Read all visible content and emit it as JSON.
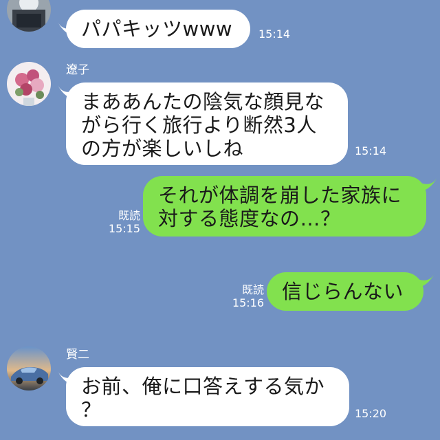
{
  "messages": [
    {
      "sender": "",
      "lines": [
        "パパキッツwww"
      ],
      "time": "15:14"
    },
    {
      "sender": "遼子",
      "lines": [
        "まああんたの陰気な顔見な",
        "がら行く旅行より断然3人",
        "の方が楽しいしね"
      ],
      "time": "15:14"
    },
    {
      "read": "既読",
      "lines": [
        "それが体調を崩した家族に",
        "対する態度なの…？"
      ],
      "time": "15:15"
    },
    {
      "read": "既読",
      "lines": [
        "信じらんない"
      ],
      "time": "15:16"
    },
    {
      "sender": "賢二",
      "lines": [
        "お前、俺に口答えする気か",
        "？"
      ],
      "time": "15:20"
    }
  ],
  "colors": {
    "background": "#7292c3",
    "incoming_bubble": "#ffffff",
    "outgoing_bubble": "#82e14e",
    "meta_text": "#ffffff"
  },
  "icons": [
    "contact-avatar",
    "contact-avatar-ryoko",
    "contact-avatar-kenji"
  ]
}
